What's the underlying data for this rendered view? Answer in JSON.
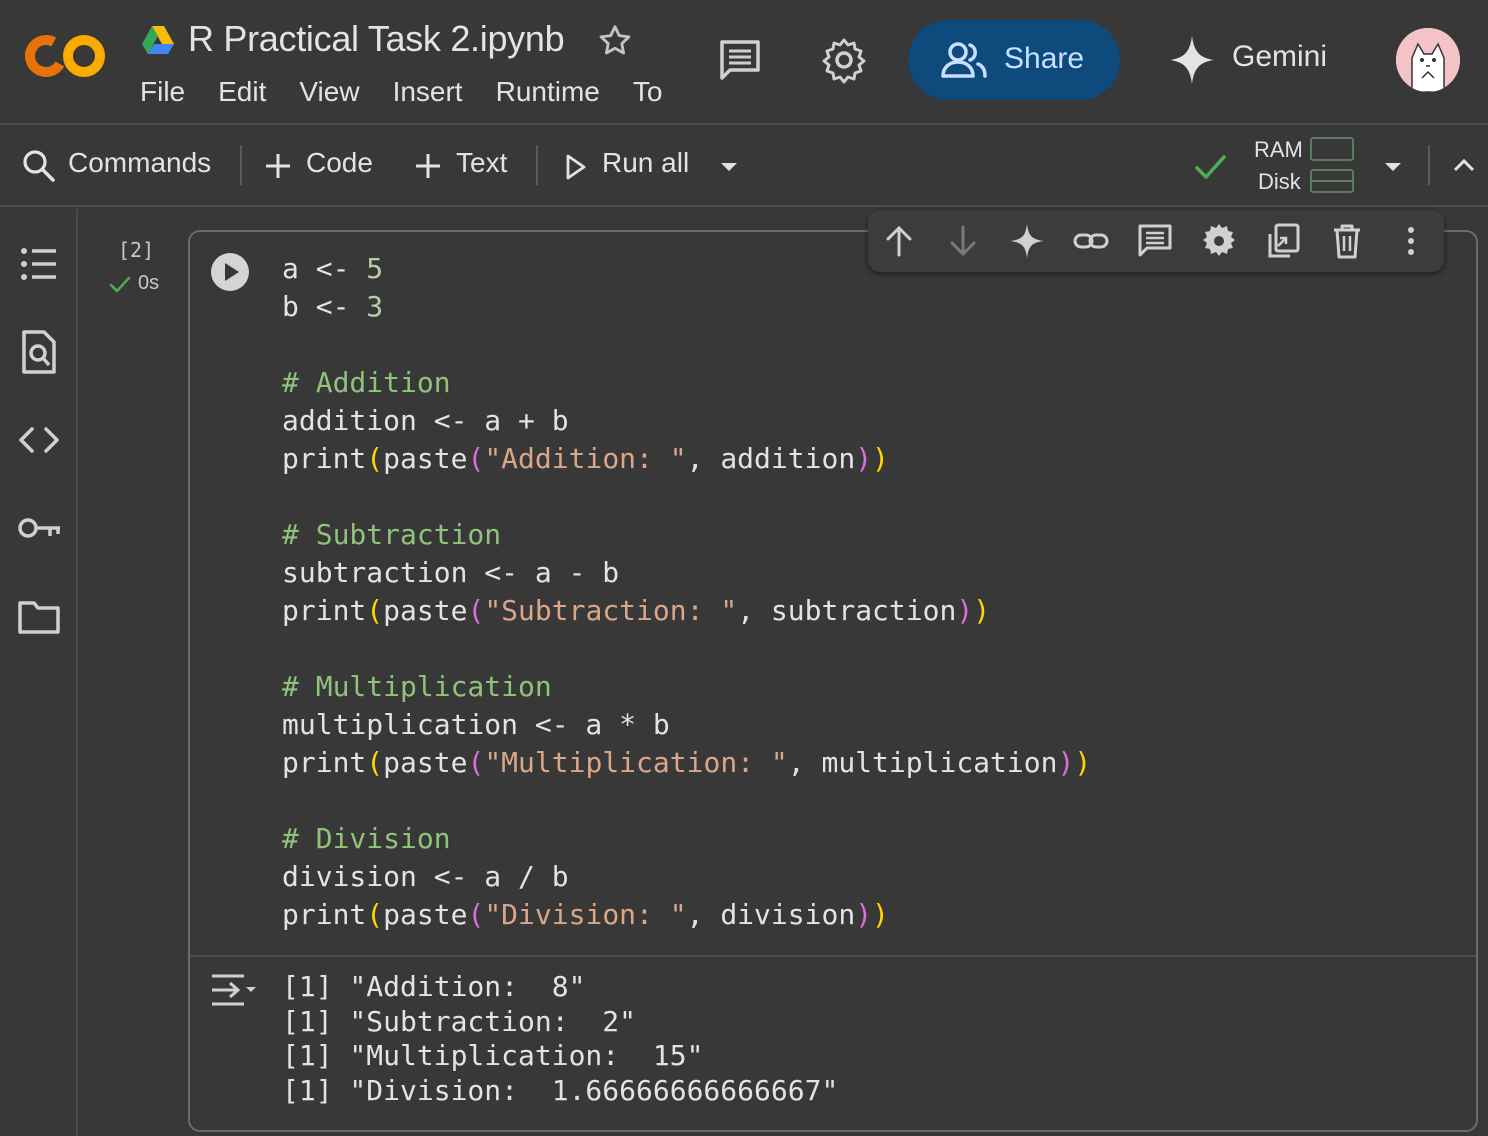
{
  "header": {
    "title": "R Practical Task 2.ipynb",
    "menu": [
      "File",
      "Edit",
      "View",
      "Insert",
      "Runtime",
      "To"
    ],
    "share_label": "Share",
    "gemini_label": "Gemini"
  },
  "toolbar": {
    "commands_label": "Commands",
    "code_label": "Code",
    "text_label": "Text",
    "run_all_label": "Run all",
    "ram_label": "RAM",
    "disk_label": "Disk"
  },
  "cell": {
    "exec_count": "[2]",
    "exec_time": "0s",
    "code_lines": [
      "a <- 5",
      "b <- 3",
      "",
      "# Addition",
      "addition <- a + b",
      "print(paste(\"Addition: \", addition))",
      "",
      "# Subtraction",
      "subtraction <- a - b",
      "print(paste(\"Subtraction: \", subtraction))",
      "",
      "# Multiplication",
      "multiplication <- a * b",
      "print(paste(\"Multiplication: \", multiplication))",
      "",
      "# Division",
      "division <- a / b",
      "print(paste(\"Division: \", division))"
    ],
    "output_lines": [
      "[1] \"Addition:  8\"",
      "[1] \"Subtraction:  2\"",
      "[1] \"Multiplication:  15\"",
      "[1] \"Division:  1.66666666666667\""
    ]
  },
  "colors": {
    "accent_share_bg": "#0f4a7d",
    "status_ok": "#4caf50",
    "logo_orange": "#f9ab00"
  }
}
